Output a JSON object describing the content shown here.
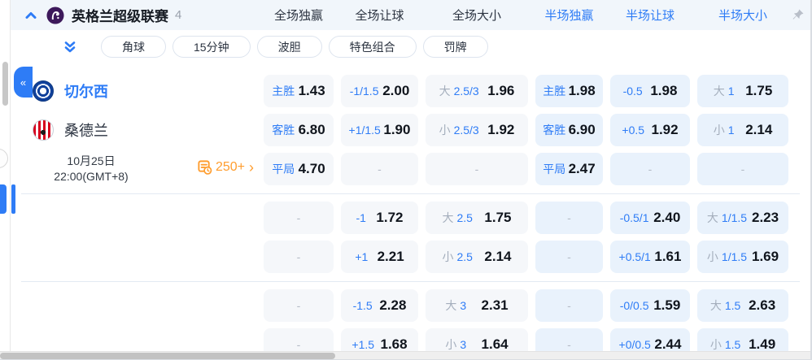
{
  "header": {
    "league_name": "英格兰超级联赛",
    "match_count": "4",
    "markets": [
      {
        "label": "全场独赢",
        "active": false
      },
      {
        "label": "全场让球",
        "active": false
      },
      {
        "label": "全场大小",
        "active": false
      },
      {
        "label": "半场独赢",
        "active": true
      },
      {
        "label": "半场让球",
        "active": true
      },
      {
        "label": "半场大小",
        "active": true
      }
    ]
  },
  "toolbar": {
    "pills": [
      "角球",
      "15分钟",
      "波胆",
      "特色组合",
      "罚牌"
    ]
  },
  "match": {
    "home_team": "切尔西",
    "away_team": "桑德兰",
    "date": "10月25日",
    "time": "22:00(GMT+8)",
    "more_count": "250+",
    "more_arrow": "›",
    "collapse_glyph": "«"
  },
  "odds": {
    "row_groups": [
      3,
      2,
      2
    ],
    "rows": [
      {
        "cells": [
          {
            "type": "pick",
            "label": "主胜",
            "value": "1.43"
          },
          {
            "type": "pick",
            "label": "-1/1.5",
            "value": "2.00"
          },
          {
            "type": "ou",
            "prefix": "大",
            "line": "2.5/3",
            "value": "1.96"
          },
          {
            "type": "pick",
            "label": "主胜",
            "value": "1.98"
          },
          {
            "type": "pick",
            "label": "-0.5",
            "value": "1.98"
          },
          {
            "type": "ou",
            "prefix": "大",
            "line": "1",
            "value": "1.75"
          }
        ]
      },
      {
        "cells": [
          {
            "type": "pick",
            "label": "客胜",
            "value": "6.80"
          },
          {
            "type": "pick",
            "label": "+1/1.5",
            "value": "1.90"
          },
          {
            "type": "ou",
            "prefix": "小",
            "line": "2.5/3",
            "value": "1.92"
          },
          {
            "type": "pick",
            "label": "客胜",
            "value": "6.90"
          },
          {
            "type": "pick",
            "label": "+0.5",
            "value": "1.92"
          },
          {
            "type": "ou",
            "prefix": "小",
            "line": "1",
            "value": "2.14"
          }
        ]
      },
      {
        "cells": [
          {
            "type": "pick",
            "label": "平局",
            "value": "4.70"
          },
          {
            "type": "dash"
          },
          {
            "type": "dash"
          },
          {
            "type": "pick",
            "label": "平局",
            "value": "2.47"
          },
          {
            "type": "dash"
          },
          {
            "type": "dash"
          }
        ]
      },
      {
        "cells": [
          {
            "type": "dash"
          },
          {
            "type": "pick",
            "label": "-1",
            "value": "1.72"
          },
          {
            "type": "ou",
            "prefix": "大",
            "line": "2.5",
            "value": "1.75"
          },
          {
            "type": "dash"
          },
          {
            "type": "pick",
            "label": "-0.5/1",
            "value": "2.40"
          },
          {
            "type": "ou",
            "prefix": "大",
            "line": "1/1.5",
            "value": "2.23"
          }
        ]
      },
      {
        "cells": [
          {
            "type": "dash"
          },
          {
            "type": "pick",
            "label": "+1",
            "value": "2.21"
          },
          {
            "type": "ou",
            "prefix": "小",
            "line": "2.5",
            "value": "2.14"
          },
          {
            "type": "dash"
          },
          {
            "type": "pick",
            "label": "+0.5/1",
            "value": "1.61"
          },
          {
            "type": "ou",
            "prefix": "小",
            "line": "1/1.5",
            "value": "1.69"
          }
        ]
      },
      {
        "cells": [
          {
            "type": "dash"
          },
          {
            "type": "pick",
            "label": "-1.5",
            "value": "2.28"
          },
          {
            "type": "ou",
            "prefix": "大",
            "line": "3",
            "value": "2.31"
          },
          {
            "type": "dash"
          },
          {
            "type": "pick",
            "label": "-0/0.5",
            "value": "1.59"
          },
          {
            "type": "ou",
            "prefix": "大",
            "line": "1.5",
            "value": "2.63"
          }
        ]
      },
      {
        "cells": [
          {
            "type": "dash"
          },
          {
            "type": "pick",
            "label": "+1.5",
            "value": "1.68"
          },
          {
            "type": "ou",
            "prefix": "小",
            "line": "3",
            "value": "1.64"
          },
          {
            "type": "dash"
          },
          {
            "type": "pick",
            "label": "+0/0.5",
            "value": "2.44"
          },
          {
            "type": "ou",
            "prefix": "小",
            "line": "1.5",
            "value": "1.49"
          }
        ]
      }
    ]
  },
  "colors": {
    "accent": "#2e7cf6",
    "orange": "#ff9d2e",
    "cell-ft": "#f5f7fa",
    "cell-ht": "#e9f2fc",
    "ou-prefix": "#a4aebc"
  }
}
